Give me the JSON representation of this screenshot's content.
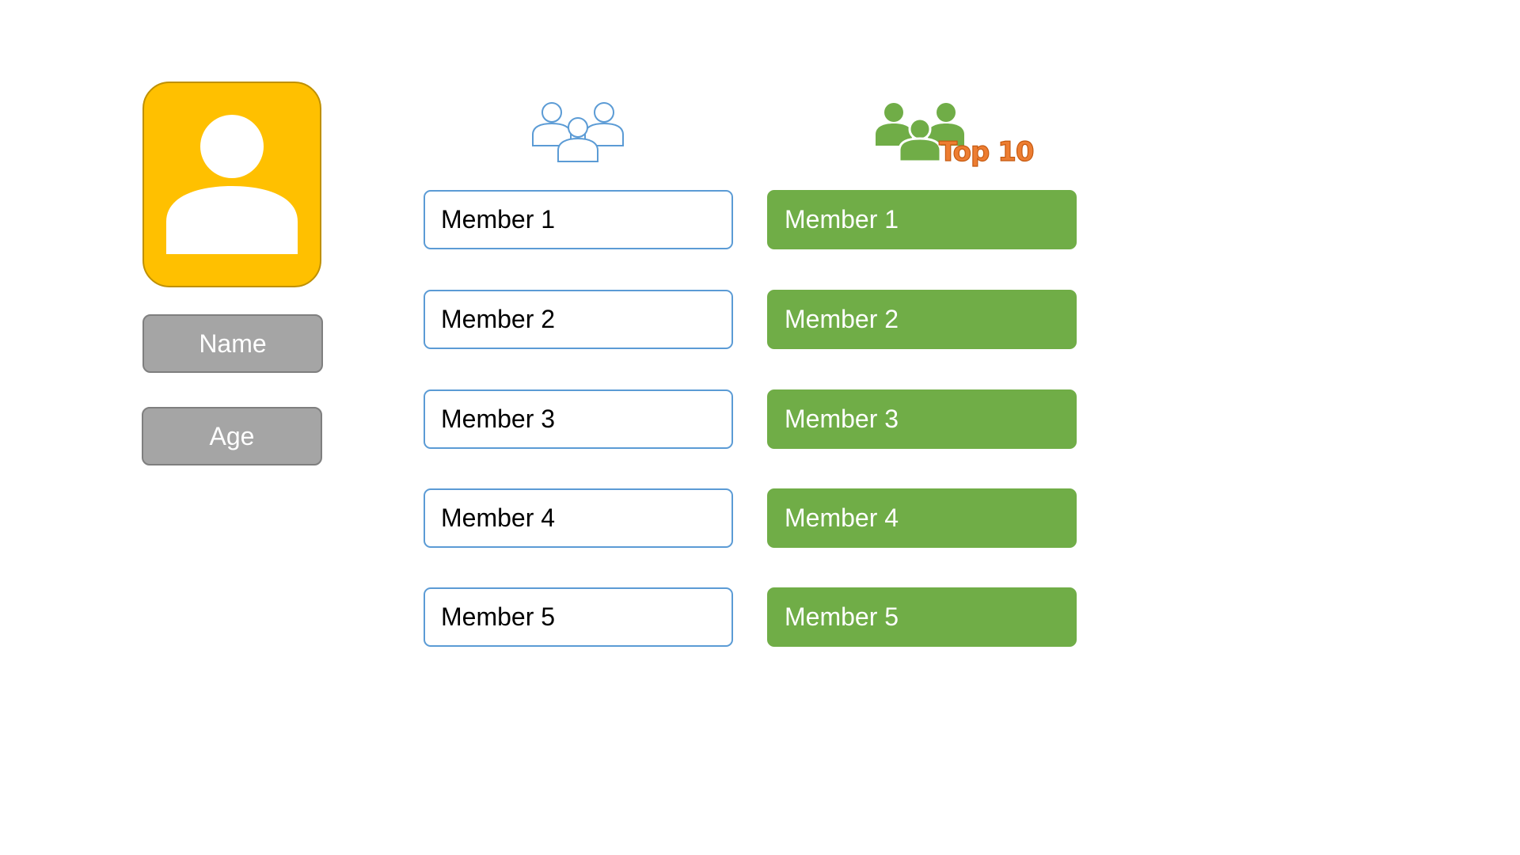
{
  "profile": {
    "avatar_icon": "user-icon",
    "name_label": "Name",
    "age_label": "Age"
  },
  "members": {
    "header_icon": "group-outline-icon",
    "items": [
      {
        "label": "Member 1"
      },
      {
        "label": "Member 2"
      },
      {
        "label": "Member 3"
      },
      {
        "label": "Member 4"
      },
      {
        "label": "Member 5"
      }
    ]
  },
  "top_members": {
    "header_icon": "group-filled-icon",
    "badge": "Top 10",
    "items": [
      {
        "label": "Member 1"
      },
      {
        "label": "Member 2"
      },
      {
        "label": "Member 3"
      },
      {
        "label": "Member 4"
      },
      {
        "label": "Member 5"
      }
    ]
  },
  "colors": {
    "avatar_fill": "#ffc000",
    "field_fill": "#a5a5a5",
    "member_border": "#5b9bd5",
    "top_fill": "#70ad47",
    "badge": "#ed7d31"
  }
}
